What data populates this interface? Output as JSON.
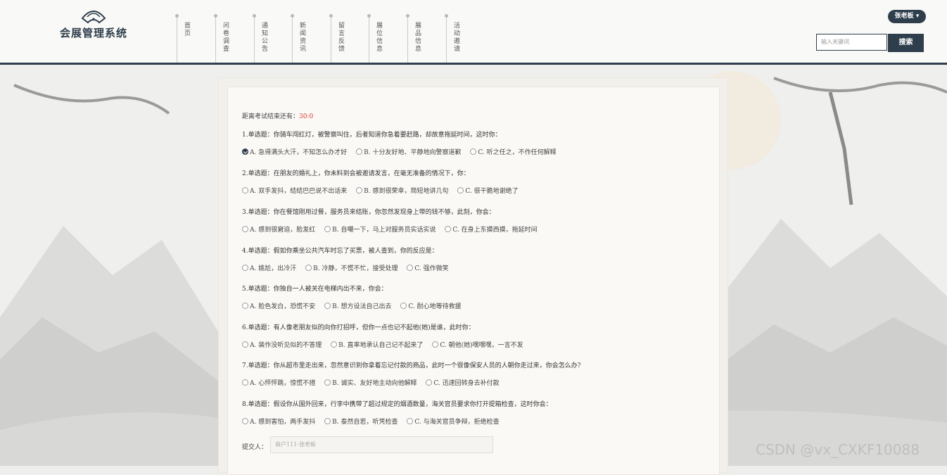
{
  "app": {
    "title": "会展管理系统",
    "brand_color": "#2f3e4c"
  },
  "nav": {
    "items": [
      {
        "label": "首页"
      },
      {
        "label": "问卷调查"
      },
      {
        "label": "通知公告"
      },
      {
        "label": "新闻资讯"
      },
      {
        "label": "留言反馈"
      },
      {
        "label": "展位信息"
      },
      {
        "label": "展品信息"
      },
      {
        "label": "活动邀请"
      }
    ]
  },
  "user": {
    "name": "张老板"
  },
  "search": {
    "placeholder": "输入关键词",
    "button_label": "搜索"
  },
  "exam": {
    "timer_label": "距离考试结束还有：",
    "timer_value": "30:0",
    "questions": [
      {
        "title": "1.单选题：你骑车闯红灯，被警察叫住，后者知道你急着要赶路，却故意拖延时间，这时你：",
        "options": [
          "A. 急得满头大汗，不知怎么办才好",
          "B. 十分友好地、平静地向警察道歉",
          "C. 听之任之，不作任何解释"
        ],
        "selected": 0
      },
      {
        "title": "2.单选题：在朋友的婚礼上，你未料到会被邀请发言，在毫无准备的情况下，你：",
        "options": [
          "A. 双手发抖，结结巴巴说不出话来",
          "B. 感到很荣幸，简短地讲几句",
          "C. 很干脆地谢绝了"
        ],
        "selected": -1
      },
      {
        "title": "3.单选题：你在餐馆刚用过餐，服务员来结账，你忽然发现身上带的钱不够，此刻，你会：",
        "options": [
          "A. 感到很窘迫，脸发红",
          "B. 自嘲一下，马上对服务员实话实说",
          "C. 在身上东摸西摸，拖延时间"
        ],
        "selected": -1
      },
      {
        "title": "4.单选题：假如你乘坐公共汽车时忘了买票，被人查到，你的反应是：",
        "options": [
          "A. 尴尬，出冷汗",
          "B. 冷静，不慌不忙，接受处理",
          "C. 强作微笑"
        ],
        "selected": -1
      },
      {
        "title": "5.单选题：你独自一人被关在电梯内出不来，你会：",
        "options": [
          "A. 脸色发白，恐慌不安",
          "B. 想方设法自己出去",
          "C. 耐心地等待救援"
        ],
        "selected": -1
      },
      {
        "title": "6.单选题：有人像老朋友似的向你打招呼，但你一点也记不起他(她)是谁，此时你：",
        "options": [
          "A. 装作没听见似的不答理",
          "B. 直率地承认自己记不起来了",
          "C. 朝他(她)嘿嘿嘿，一言不发"
        ],
        "selected": -1
      },
      {
        "title": "7.单选题：你从超市里走出来，忽然意识到你拿着忘记付款的商品，此时一个很像保安人员的人朝你走过来，你会怎么办?",
        "options": [
          "A. 心怦怦跳，惊慌不措",
          "B. 诚实、友好地主动向他解释",
          "C. 迅速回转身去补付款"
        ],
        "selected": -1
      },
      {
        "title": "8.单选题：假设你从国外回来，行李中携带了超过规定的烟酒数量，海关官员要求你打开提箱检查，这时你会：",
        "options": [
          "A. 感到害怕，两手发抖",
          "B. 泰然自若，听凭检查",
          "C. 与海关官员争辩，拒绝检查"
        ],
        "selected": -1
      }
    ],
    "submitter_label": "提交人：",
    "submitter_value": "商户111-张老板"
  },
  "watermark": "CSDN @vx_CXKF10088"
}
